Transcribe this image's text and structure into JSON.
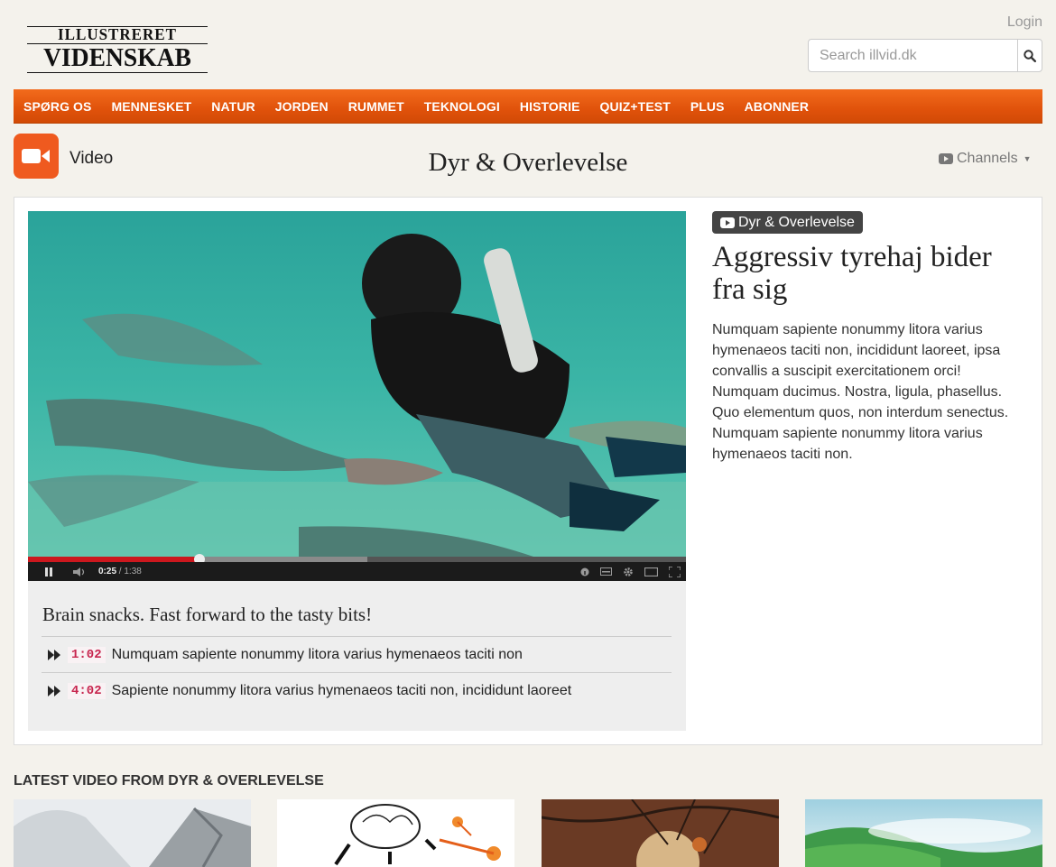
{
  "header": {
    "logo_top": "ILLUSTRERET",
    "logo_bottom": "VIDENSKAB",
    "login": "Login",
    "search_placeholder": "Search illvid.dk"
  },
  "nav": [
    "SPØRG OS",
    "MENNESKET",
    "NATUR",
    "JORDEN",
    "RUMMET",
    "TEKNOLOGI",
    "HISTORIE",
    "QUIZ+TEST",
    "PLUS",
    "ABONNER"
  ],
  "section": {
    "label": "Video",
    "title": "Dyr & Overlevelse",
    "channels": "Channels"
  },
  "player": {
    "current_time": "0:25",
    "duration": "1:38",
    "progress_fraction": 0.261,
    "buffered_fraction": 0.516
  },
  "snacks": {
    "heading": "Brain snacks. Fast forward to the tasty bits!",
    "items": [
      {
        "time": "1:02",
        "text": "Numquam sapiente nonummy litora varius hymenaeos taciti non"
      },
      {
        "time": "4:02",
        "text": "Sapiente nonummy litora varius hymenaeos taciti non, incididunt laoreet"
      }
    ]
  },
  "article": {
    "category": "Dyr & Overlevelse",
    "headline": "Aggressiv tyrehaj bider fra sig",
    "description": "Numquam sapiente nonummy litora varius hymenaeos taciti non, incididunt laoreet, ipsa convallis a suscipit exercitationem orci! Numquam ducimus. Nostra, ligula, phasellus. Quo elementum quos, non interdum senectus. Numquam sapiente nonummy litora varius hymenaeos taciti non."
  },
  "latest": {
    "title": "LATEST VIDEO FROM DYR & OVERLEVELSE"
  },
  "colors": {
    "nav_orange": "#e0520b",
    "video_icon": "#ef5a1f",
    "progress_red": "#cc181e",
    "timestamp_red": "#c7254e"
  }
}
